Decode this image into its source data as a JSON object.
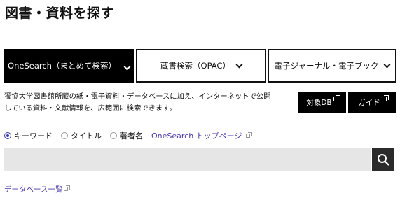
{
  "page": {
    "title": "図書・資料を探す"
  },
  "tabs": [
    {
      "label": "OneSearch（まとめて検索）",
      "active": true
    },
    {
      "label": "蔵書検索（OPAC）",
      "active": false
    },
    {
      "label": "電子ジャーナル・電子ブック",
      "active": false
    }
  ],
  "description": {
    "line1": "獨協大学図書館所蔵の紙・電子資料・データベースに加え、インターネットで公開",
    "line2": "している資料・文献情報を、広範囲に検索できます。"
  },
  "buttons": {
    "target_db": "対象DB",
    "guide": "ガイド"
  },
  "search_options": {
    "radios": [
      {
        "label": "キーワード",
        "selected": true
      },
      {
        "label": "タイトル",
        "selected": false
      },
      {
        "label": "著者名",
        "selected": false
      }
    ],
    "top_page_link": "OneSearch トップページ"
  },
  "search": {
    "value": "",
    "placeholder": ""
  },
  "footer": {
    "database_list_link": "データベース一覧"
  },
  "icons": {
    "search": "search-icon",
    "external": "external-link-icon",
    "dropdown": "chevron-down-icon"
  },
  "colors": {
    "active_tab": "#000000",
    "link": "#4a3aa6",
    "search_bg": "#e6e6e6",
    "search_button": "#2b2b2b"
  }
}
